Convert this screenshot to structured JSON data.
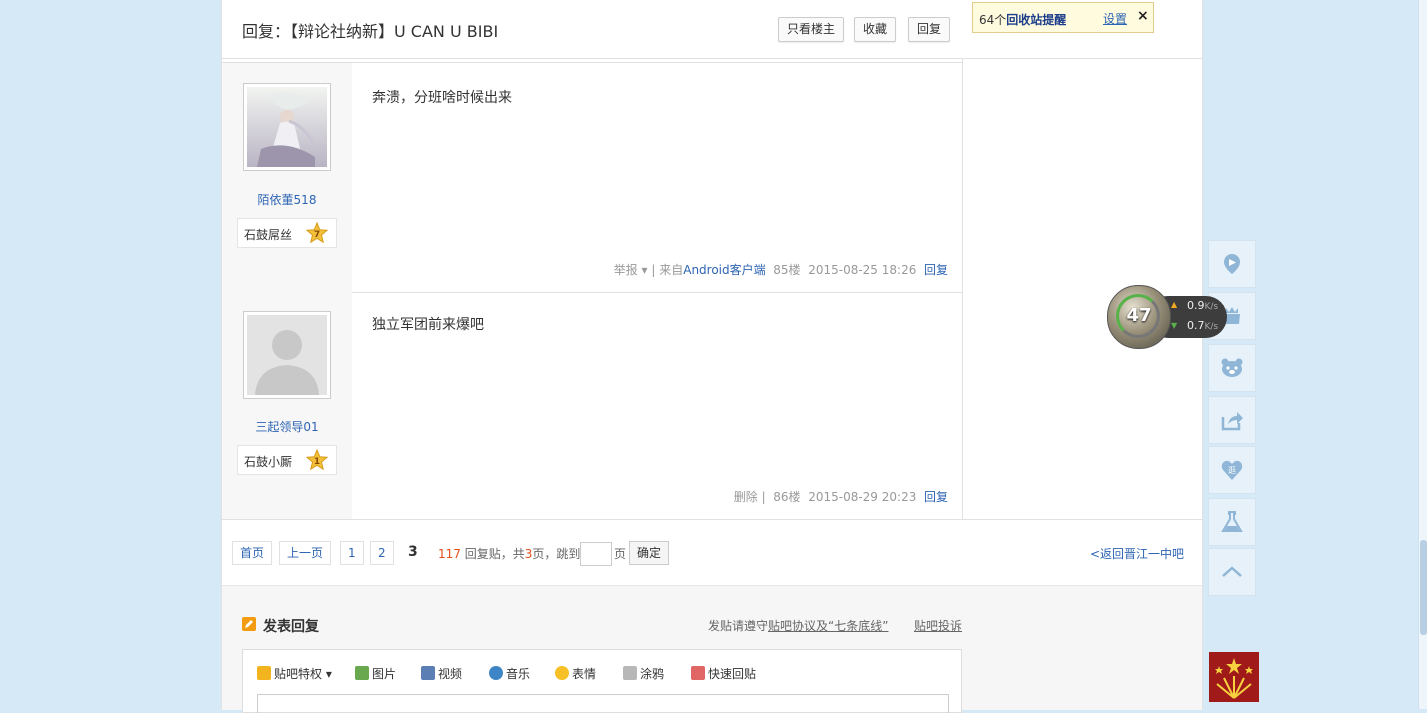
{
  "header": {
    "title": "回复：【辩论社纳新】U CAN U BIBI",
    "btn_only_op": "只看楼主",
    "btn_collect": "收藏",
    "btn_reply": "回复"
  },
  "recycle_tip": {
    "count_prefix": "64个",
    "link": "回收站提醒",
    "settings": "设置",
    "close": "×"
  },
  "posts": [
    {
      "username": "陌依董518",
      "badge": "石鼓屌丝",
      "level": "7",
      "content": "奔溃，分班啥时候出来",
      "action": "举报",
      "source_prefix": "| 来自",
      "source": "Android客户端",
      "floor": "85楼",
      "time": "2015-08-25 18:26",
      "reply": "回复"
    },
    {
      "username": "三起领导01",
      "badge": "石鼓小厮",
      "level": "1",
      "content": "独立军团前来爆吧",
      "action": "删除",
      "source_prefix": "|",
      "source": "",
      "floor": "86楼",
      "time": "2015-08-29 20:23",
      "reply": "回复"
    }
  ],
  "pagination": {
    "first": "首页",
    "prev": "上一页",
    "pages": [
      "1",
      "2"
    ],
    "current": "3",
    "total_posts": "117",
    "posts_text": "回复贴，共",
    "total_pages": "3",
    "pages_text": "页，跳到",
    "page_unit": "页",
    "confirm": "确定",
    "back_link": "<返回晋江一中吧"
  },
  "reply_section": {
    "title": "发表回复",
    "rules_prefix": "发贴请遵守",
    "rules_link": "贴吧协议及“七条底线”",
    "complaint": "贴吧投诉",
    "toolbar": [
      "贴吧特权",
      "图片",
      "视频",
      "音乐",
      "表情",
      "涂鸦",
      "快速回贴"
    ]
  },
  "speed_widget": {
    "percent": "47",
    "upload": "0.9",
    "download": "0.7",
    "unit": "K/s"
  },
  "icons": [
    "location-icon",
    "hat-icon",
    "bear-icon",
    "share-icon",
    "heart-icon",
    "flask-icon",
    "back-to-top-icon"
  ],
  "colors": {
    "link": "#2d64b3",
    "accent_orange": "#e64d1b",
    "page_bg": "#d5e9f7"
  }
}
